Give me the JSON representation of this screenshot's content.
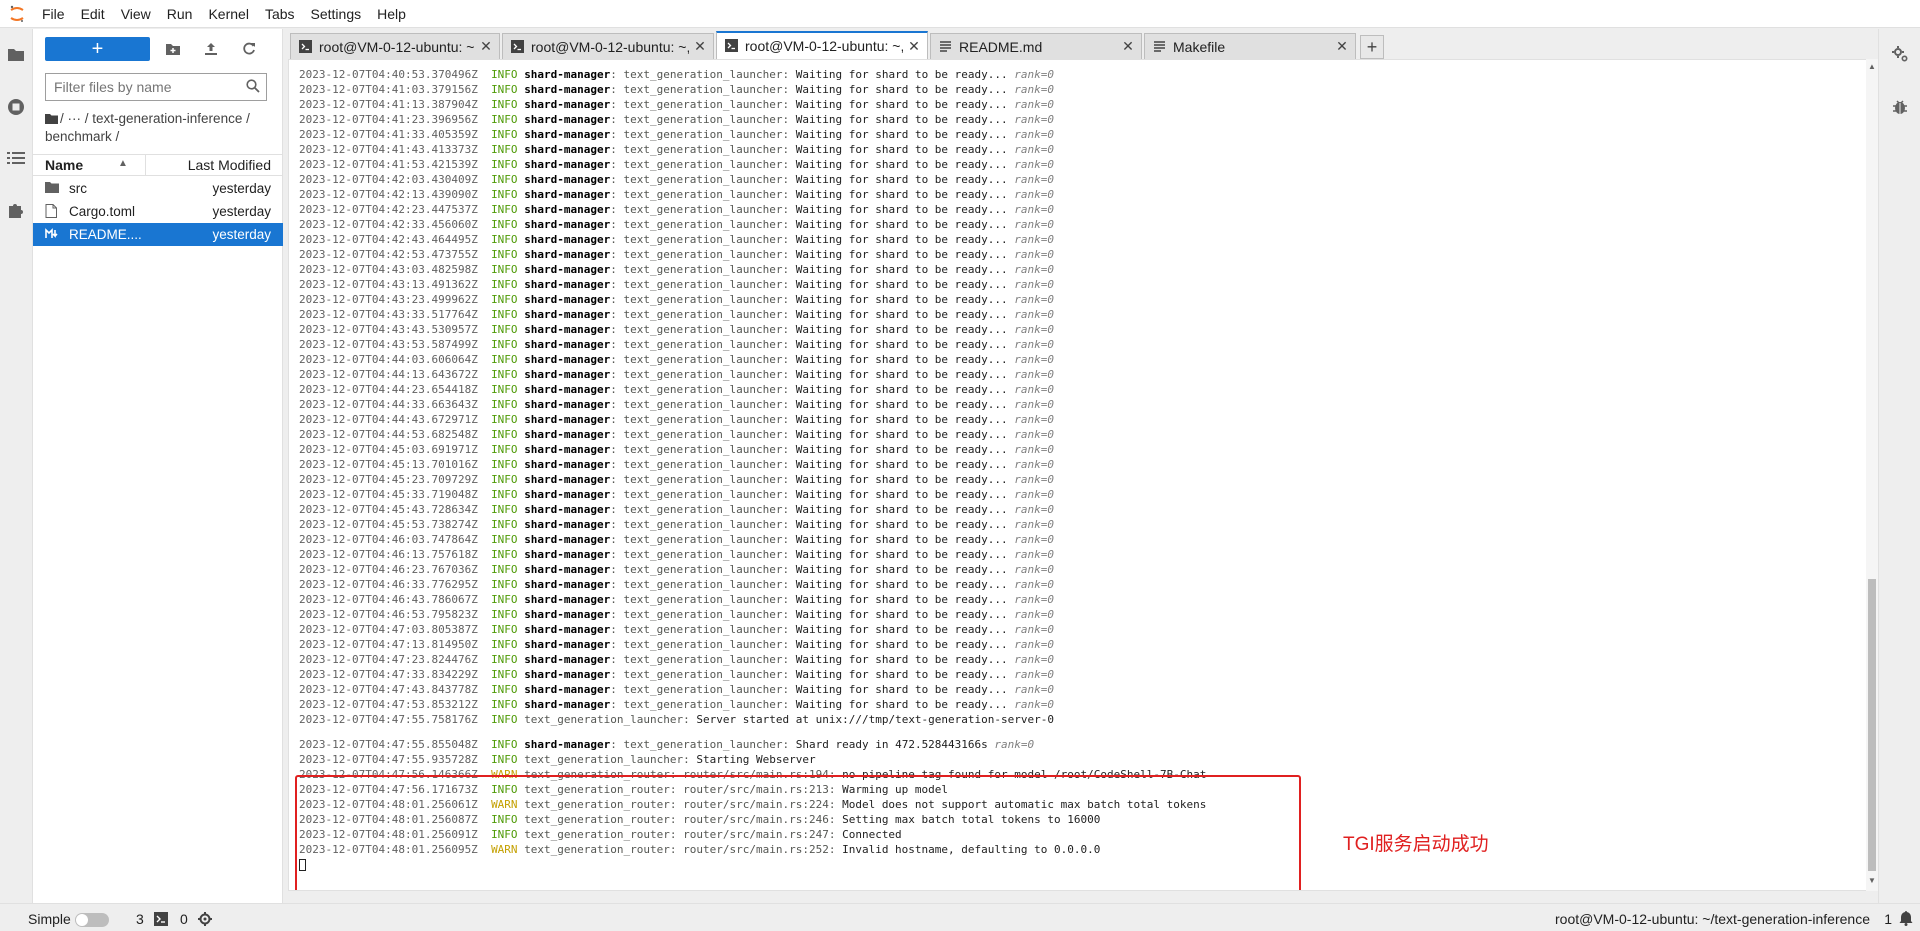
{
  "menu": [
    "File",
    "Edit",
    "View",
    "Run",
    "Kernel",
    "Tabs",
    "Settings",
    "Help"
  ],
  "filebrowser": {
    "new_label": "+",
    "search_placeholder": "Filter files by name",
    "breadcrumbs": "/  ···  / text-generation-inference / benchmark /",
    "col_name": "Name",
    "col_modified": "Last Modified",
    "files": [
      {
        "name": "src",
        "modified": "yesterday",
        "icon": "folder-icon"
      },
      {
        "name": "Cargo.toml",
        "modified": "yesterday",
        "icon": "file-icon"
      },
      {
        "name": "README....",
        "modified": "yesterday",
        "icon": "markdown-icon",
        "selected": true
      }
    ]
  },
  "tabs": [
    {
      "label": "root@VM-0-12-ubuntu: ~",
      "icon": "terminal-icon",
      "active": false
    },
    {
      "label": "root@VM-0-12-ubuntu: ~,",
      "icon": "terminal-icon",
      "active": false
    },
    {
      "label": "root@VM-0-12-ubuntu: ~,",
      "icon": "terminal-icon",
      "active": true
    },
    {
      "label": "README.md",
      "icon": "text-file-icon",
      "active": false
    },
    {
      "label": "Makefile",
      "icon": "text-file-icon",
      "active": false
    }
  ],
  "terminal": {
    "waiting_msg": "Waiting for shard to be ready...",
    "waiting_kv": "rank=0",
    "waiting_times": [
      "40:53.370496Z",
      "41:03.379156Z",
      "41:13.387904Z",
      "41:23.396956Z",
      "41:33.405359Z",
      "41:43.413373Z",
      "41:53.421539Z",
      "42:03.430409Z",
      "42:13.439090Z",
      "42:23.447537Z",
      "42:33.456060Z",
      "42:43.464495Z",
      "42:53.473755Z",
      "43:03.482598Z",
      "43:13.491362Z",
      "43:23.499962Z",
      "43:33.517764Z",
      "43:43.530957Z",
      "43:53.587499Z",
      "44:03.606064Z",
      "44:13.643672Z",
      "44:23.654418Z",
      "44:33.663643Z",
      "44:43.672971Z",
      "44:53.682548Z",
      "45:03.691971Z",
      "45:13.701016Z",
      "45:23.709729Z",
      "45:33.719048Z",
      "45:43.728634Z",
      "45:53.738274Z",
      "46:03.747864Z",
      "46:13.757618Z",
      "46:23.767036Z",
      "46:33.776295Z",
      "46:43.786067Z",
      "46:53.795823Z",
      "47:03.805387Z",
      "47:13.814950Z",
      "47:23.824476Z",
      "47:33.834229Z",
      "47:43.843778Z",
      "47:53.853212Z"
    ],
    "date_prefix": "2023-12-07T04:",
    "lines": [
      {
        "ts": "2023-12-07T04:47:55.758176Z",
        "level": "INFO",
        "target": "text_generation_launcher:",
        "bold_target": "",
        "msg": "Server started at unix:///tmp/text-generation-server-0",
        "kv": ""
      },
      {
        "ts": "2023-12-07T04:47:55.855048Z",
        "level": "INFO",
        "target": "text_generation_launcher:",
        "bold_target": "shard-manager",
        "msg": "Shard ready in 472.528443166s",
        "kv": "rank=0"
      },
      {
        "ts": "2023-12-07T04:47:55.935728Z",
        "level": "INFO",
        "target": "text_generation_launcher:",
        "bold_target": "",
        "msg": "Starting Webserver",
        "kv": ""
      },
      {
        "ts": "2023-12-07T04:47:56.146366Z",
        "level": "WARN",
        "target": "text_generation_router: router/src/main.rs:194:",
        "bold_target": "",
        "msg": "no pipeline tag found for model /root/CodeShell-7B-Chat",
        "kv": ""
      },
      {
        "ts": "2023-12-07T04:47:56.171673Z",
        "level": "INFO",
        "target": "text_generation_router: router/src/main.rs:213:",
        "bold_target": "",
        "msg": "Warming up model",
        "kv": ""
      },
      {
        "ts": "2023-12-07T04:48:01.256061Z",
        "level": "WARN",
        "target": "text_generation_router: router/src/main.rs:224:",
        "bold_target": "",
        "msg": "Model does not support automatic max batch total tokens",
        "kv": ""
      },
      {
        "ts": "2023-12-07T04:48:01.256087Z",
        "level": "INFO",
        "target": "text_generation_router: router/src/main.rs:246:",
        "bold_target": "",
        "msg": "Setting max batch total tokens to 16000",
        "kv": ""
      },
      {
        "ts": "2023-12-07T04:48:01.256091Z",
        "level": "INFO",
        "target": "text_generation_router: router/src/main.rs:247:",
        "bold_target": "",
        "msg": "Connected",
        "kv": ""
      },
      {
        "ts": "2023-12-07T04:48:01.256095Z",
        "level": "WARN",
        "target": "text_generation_router: router/src/main.rs:252:",
        "bold_target": "",
        "msg": "Invalid hostname, defaulting to 0.0.0.0",
        "kv": ""
      }
    ],
    "bold_target_label": "shard-manager:",
    "plain_target_label": "text_generation_launcher:",
    "annotation": "TGI服务启动成功"
  },
  "statusbar": {
    "simple_label": "Simple",
    "terminal_count": "3",
    "kernel_count": "0",
    "right_text": "root@VM-0-12-ubuntu: ~/text-generation-inference",
    "notification_count": "1"
  },
  "colors": {
    "accent": "#1976d2",
    "highlight": "#e02020",
    "info": "#4e9a06",
    "warn": "#c4a000"
  }
}
